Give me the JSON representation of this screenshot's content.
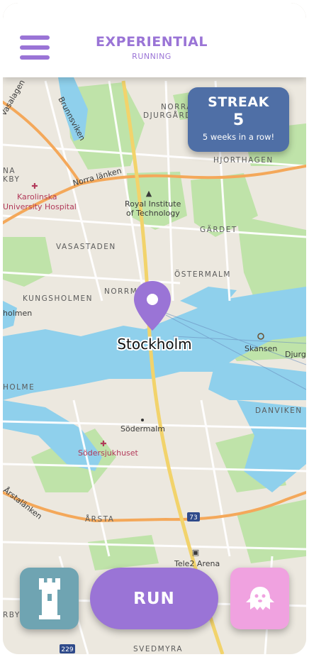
{
  "app": {
    "title": "EXPERIENTIAL",
    "subtitle": "RUNNING"
  },
  "colors": {
    "accent": "#9a74d6",
    "streak": "#4f6fa6",
    "tower": "#6fa4b2",
    "ghost": "#f0a2e0",
    "water": "#8fd0ec",
    "park": "#bfe3a9",
    "road": "#f4a85a"
  },
  "streak": {
    "title": "STREAK",
    "count": "5",
    "caption": "5 weeks in a row!"
  },
  "map": {
    "city": "Stockholm",
    "labels": {
      "brunnsviken": "Brunnsviken",
      "vasalagen": "Vasalagen",
      "norra_aug": "NORRA",
      "djurgarden": "DJURGÅRDEN",
      "hjorthagen": "HJORTHAGEN",
      "norra_lanken": "Norra länken",
      "karolinska": "Karolinska",
      "university_hospital": "University Hospital",
      "royal_institute": "Royal Institute",
      "of_technology": "of Technology",
      "gardet": "GÄRDET",
      "vasastaden": "VASASTADEN",
      "ostermalm": "ÖSTERMALM",
      "kungsholmen": "KUNGSHOLMEN",
      "norrm": "NORRM",
      "holmen": "holmen",
      "skansen": "Skansen",
      "djurg": "Djurg",
      "holme": "HOLME",
      "danviken": "DANVIKEN",
      "sodermalm": "Södermalm",
      "sodersjukhuset": "Södersjukhuset",
      "arstalanken": "Årstalänken",
      "arsta": "ÅRSTA",
      "route73": "73",
      "tele2": "Tele2 Arena",
      "route229": "229",
      "svedmyra": "SVEDMYRA",
      "na": "NA",
      "kby": "KBY",
      "rby": "RBY"
    }
  },
  "actions": {
    "run_label": "RUN",
    "tower_icon": "tower-icon",
    "ghost_icon": "ghost-icon",
    "menu_icon": "hamburger-menu-icon"
  }
}
